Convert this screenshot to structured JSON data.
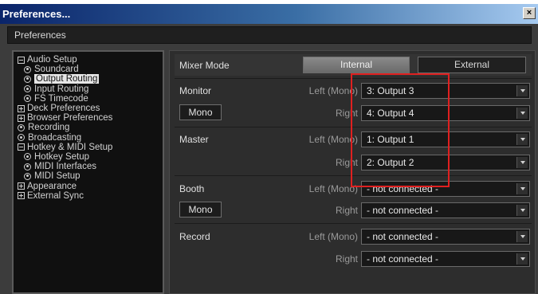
{
  "window": {
    "title": "Preferences...",
    "close_glyph": "×"
  },
  "header": {
    "title": "Preferences"
  },
  "tree": [
    {
      "label": "Audio Setup",
      "marker": "minus",
      "child": false,
      "selected": false
    },
    {
      "label": "Soundcard",
      "marker": "dot",
      "child": true,
      "selected": false
    },
    {
      "label": "Output Routing",
      "marker": "dot",
      "child": true,
      "selected": true
    },
    {
      "label": "Input Routing",
      "marker": "dot",
      "child": true,
      "selected": false
    },
    {
      "label": "FS Timecode",
      "marker": "dot",
      "child": true,
      "selected": false
    },
    {
      "label": "Deck Preferences",
      "marker": "plus",
      "child": false,
      "selected": false
    },
    {
      "label": "Browser Preferences",
      "marker": "plus",
      "child": false,
      "selected": false
    },
    {
      "label": "Recording",
      "marker": "dot",
      "child": false,
      "selected": false
    },
    {
      "label": "Broadcasting",
      "marker": "dot",
      "child": false,
      "selected": false
    },
    {
      "label": "Hotkey & MIDI Setup",
      "marker": "minus",
      "child": false,
      "selected": false
    },
    {
      "label": "Hotkey Setup",
      "marker": "dot",
      "child": true,
      "selected": false
    },
    {
      "label": "MIDI Interfaces",
      "marker": "dot",
      "child": true,
      "selected": false
    },
    {
      "label": "MIDI Setup",
      "marker": "dot",
      "child": true,
      "selected": false
    },
    {
      "label": "Appearance",
      "marker": "plus",
      "child": false,
      "selected": false
    },
    {
      "label": "External Sync",
      "marker": "plus",
      "child": false,
      "selected": false
    }
  ],
  "mixer": {
    "label": "Mixer Mode",
    "internal_label": "Internal",
    "external_label": "External",
    "selected": "Internal"
  },
  "sections": {
    "monitor": {
      "label": "Monitor",
      "mono_label": "Mono",
      "left_label": "Left (Mono)",
      "right_label": "Right",
      "left_value": "3: Output 3",
      "right_value": "4: Output 4"
    },
    "master": {
      "label": "Master",
      "left_label": "Left (Mono)",
      "right_label": "Right",
      "left_value": "1: Output 1",
      "right_value": "2: Output 2"
    },
    "booth": {
      "label": "Booth",
      "mono_label": "Mono",
      "left_label": "Left (Mono)",
      "right_label": "Right",
      "left_value": "- not connected -",
      "right_value": "- not connected -"
    },
    "record": {
      "label": "Record",
      "left_label": "Left (Mono)",
      "right_label": "Right",
      "left_value": "- not connected -",
      "right_value": "- not connected -"
    }
  },
  "colors": {
    "accent_highlight": "#e02020",
    "panel_bg": "#2d2d2d",
    "title_bar": "#0a246a"
  }
}
